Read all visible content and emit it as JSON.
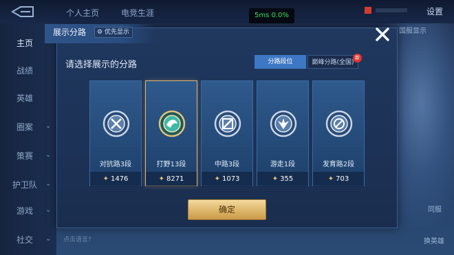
{
  "topbar": {
    "nav": [
      "个人主页",
      "电竞生涯"
    ],
    "ping": "5ms  0.0%",
    "settings_label": "设置"
  },
  "sidebar": {
    "items": [
      {
        "label": "主页",
        "active": true
      },
      {
        "label": "战绩",
        "active": false
      },
      {
        "label": "英雄",
        "active": false
      },
      {
        "label": "圈案",
        "active": false
      },
      {
        "label": "策赛",
        "active": false
      },
      {
        "label": "护卫队",
        "active": false
      },
      {
        "label": "游戏",
        "active": false
      },
      {
        "label": "社交",
        "active": false
      }
    ]
  },
  "background": {
    "right_labels": [
      "国服显示",
      "同服",
      "换英雄"
    ],
    "bottom_hint": "点击语言?"
  },
  "dialog": {
    "title": "展示分路",
    "priority_label": "优先显示",
    "prompt": "请选择展示的分路",
    "tabs": [
      {
        "label": "分路段位",
        "selected": true
      },
      {
        "label": "巅峰分路(全国)",
        "selected": false,
        "badge": "新"
      }
    ],
    "cards": [
      {
        "name": "对抗路3段",
        "score": "1476",
        "icon": "lane-sword-icon",
        "selected": false
      },
      {
        "name": "打野13段",
        "score": "8271",
        "icon": "jungle-dragon-icon",
        "selected": true
      },
      {
        "name": "中路3段",
        "score": "1073",
        "icon": "mid-slash-icon",
        "selected": false
      },
      {
        "name": "游走1段",
        "score": "355",
        "icon": "roam-wings-icon",
        "selected": false
      },
      {
        "name": "发育路2段",
        "score": "703",
        "icon": "farm-crosshair-icon",
        "selected": false
      }
    ],
    "confirm_label": "确定"
  },
  "colors": {
    "accent_blue": "#3e78c4",
    "gold": "#deb66a",
    "panel": "#1c3256"
  }
}
